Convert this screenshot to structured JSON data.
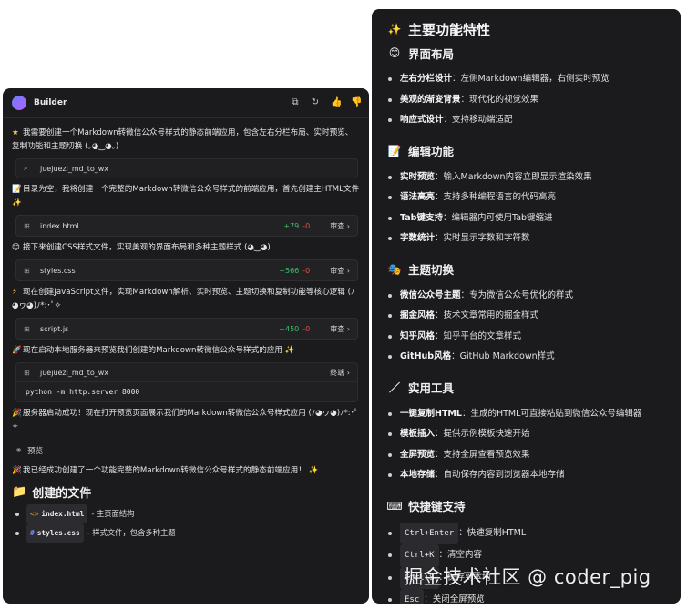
{
  "builder": {
    "title": "Builder",
    "header_icons": [
      "copy-icon",
      "refresh-icon",
      "thumbs-up-icon",
      "thumbs-down-icon"
    ],
    "user_prompt": "我需要创建一个Markdown转微信公众号样式的静态前端应用，包含左右分栏布局、实时预览、复制功能和主题切换 (｡◕‿◕｡)",
    "chip_workspace": "juejuezi_md_to_wx",
    "msg_html": "目录为空，我将创建一个完整的Markdown转微信公众号样式的前端应用，首先创建主HTML文件",
    "file_html": {
      "name": "index.html",
      "add": "+79",
      "del": "-0",
      "review": "审查"
    },
    "msg_css": "接下来创建CSS样式文件，实现美观的界面布局和多种主题样式 (◕‿◕)",
    "file_css": {
      "name": "styles.css",
      "add": "+566",
      "del": "-0",
      "review": "审查"
    },
    "msg_js": "现在创建JavaScript文件，实现Markdown解析、实时预览、主题切换和复制功能等核心逻辑 (ﾉ◕ヮ◕)ﾉ*:･ﾟ✧",
    "file_js": {
      "name": "script.js",
      "add": "+450",
      "del": "-0",
      "review": "审查"
    },
    "msg_server": "现在启动本地服务器来预览我们创建的Markdown转微信公众号样式的应用",
    "terminal": {
      "name": "juejuezi_md_to_wx",
      "label": "终端",
      "command": "python -m http.server 8000"
    },
    "msg_started": "服务器启动成功！现在打开预览页面展示我们的Markdown转微信公众号样式应用 (ﾉ◕ヮ◕)ﾉ*:･ﾟ✧",
    "preview_label": "预览",
    "msg_done": "我已经成功创建了一个功能完整的Markdown转微信公众号样式的静态前端应用！",
    "created_files_heading": "创建的文件",
    "created_files": [
      {
        "name": "index.html",
        "desc": "- 主页面结构"
      },
      {
        "name": "styles.css",
        "desc": "- 样式文件，包含多种主题"
      }
    ]
  },
  "features": {
    "title": "主要功能特性",
    "sections": [
      {
        "heading": "界面布局",
        "emoji": "😊",
        "items": [
          {
            "bold": "左右分栏设计",
            "text": "：左侧Markdown编辑器，右侧实时预览"
          },
          {
            "bold": "美观的渐变背景",
            "text": "：现代化的视觉效果"
          },
          {
            "bold": "响应式设计",
            "text": "：支持移动端适配"
          }
        ]
      },
      {
        "heading": "编辑功能",
        "emoji": "📝",
        "items": [
          {
            "bold": "实时预览",
            "text": "：输入Markdown内容立即显示渲染效果"
          },
          {
            "bold": "语法高亮",
            "text": "：支持多种编程语言的代码高亮"
          },
          {
            "bold": "Tab键支持",
            "text": "：编辑器内可使用Tab键缩进"
          },
          {
            "bold": "字数统计",
            "text": "：实时显示字数和字符数"
          }
        ]
      },
      {
        "heading": "主题切换",
        "emoji": "🎭",
        "items": [
          {
            "bold": "微信公众号主题",
            "text": "：专为微信公众号优化的样式"
          },
          {
            "bold": "掘金风格",
            "text": "：技术文章常用的掘金样式"
          },
          {
            "bold": "知乎风格",
            "text": "：知乎平台的文章样式"
          },
          {
            "bold": "GitHub风格",
            "text": "：GitHub Markdown样式"
          }
        ]
      },
      {
        "heading": "实用工具",
        "emoji": "／",
        "items": [
          {
            "bold": "一键复制HTML",
            "text": "：生成的HTML可直接粘贴到微信公众号编辑器"
          },
          {
            "bold": "模板插入",
            "text": "：提供示例模板快速开始"
          },
          {
            "bold": "全屏预览",
            "text": "：支持全屏查看预览效果"
          },
          {
            "bold": "本地存储",
            "text": "：自动保存内容到浏览器本地存储"
          }
        ]
      }
    ],
    "shortcuts": {
      "heading": "快捷键支持",
      "emoji": "⌨",
      "items": [
        {
          "key": "Ctrl+Enter",
          "text": "：快速复制HTML"
        },
        {
          "key": "Ctrl+K",
          "text": "：清空内容"
        },
        {
          "key": "Ctrl+S",
          "text": "：保存到本地"
        },
        {
          "key": "Esc",
          "text": "：关闭全屏预览"
        }
      ]
    }
  },
  "watermark": "掘金技术社区 @ coder_pig"
}
